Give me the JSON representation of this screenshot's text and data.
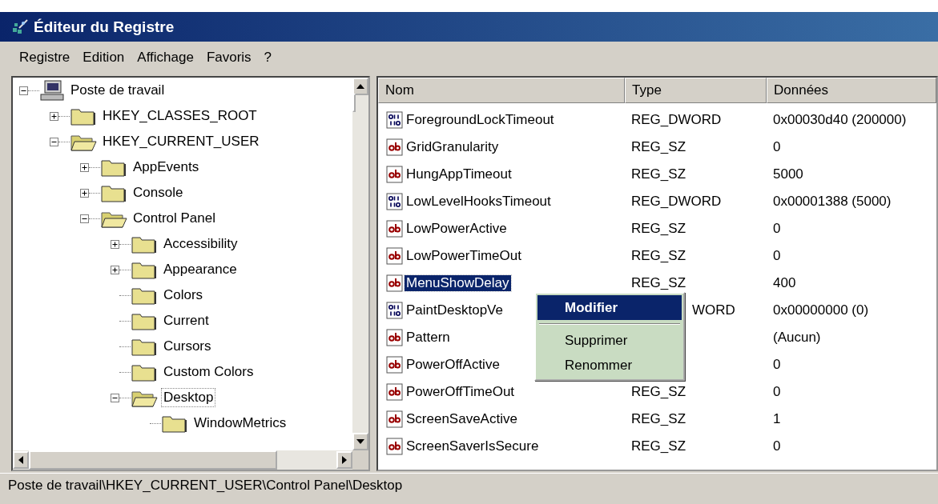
{
  "window": {
    "title": "Éditeur du Registre"
  },
  "menu_bar": [
    "Registre",
    "Edition",
    "Affichage",
    "Favoris",
    "?"
  ],
  "tree": {
    "label": "Poste de travail",
    "kind": "computer",
    "expanded": true,
    "selected": false,
    "children": [
      {
        "label": "HKEY_CLASSES_ROOT",
        "expanded": false,
        "selected": false,
        "has_children": true
      },
      {
        "label": "HKEY_CURRENT_USER",
        "expanded": true,
        "selected": false,
        "has_children": true,
        "children": [
          {
            "label": "AppEvents",
            "expanded": false,
            "selected": false,
            "has_children": true
          },
          {
            "label": "Console",
            "expanded": false,
            "selected": false,
            "has_children": true
          },
          {
            "label": "Control Panel",
            "expanded": true,
            "selected": false,
            "has_children": true,
            "children": [
              {
                "label": "Accessibility",
                "expanded": false,
                "selected": false,
                "has_children": true
              },
              {
                "label": "Appearance",
                "expanded": false,
                "selected": false,
                "has_children": true
              },
              {
                "label": "Colors",
                "selected": false,
                "has_children": false
              },
              {
                "label": "Current",
                "selected": false,
                "has_children": false
              },
              {
                "label": "Cursors",
                "selected": false,
                "has_children": false
              },
              {
                "label": "Custom Colors",
                "selected": false,
                "has_children": false
              },
              {
                "label": "Desktop",
                "expanded": true,
                "selected": true,
                "has_children": true,
                "children": [
                  {
                    "label": "WindowMetrics",
                    "selected": false,
                    "has_children": false
                  }
                ]
              }
            ]
          }
        ]
      }
    ]
  },
  "values": {
    "columns": [
      "Nom",
      "Type",
      "Données"
    ],
    "rows": [
      {
        "kind": "dword",
        "name": "ForegroundLockTimeout",
        "type": "REG_DWORD",
        "data": "0x00030d40 (200000)",
        "selected": false
      },
      {
        "kind": "string",
        "name": "GridGranularity",
        "type": "REG_SZ",
        "data": "0",
        "selected": false
      },
      {
        "kind": "string",
        "name": "HungAppTimeout",
        "type": "REG_SZ",
        "data": "5000",
        "selected": false
      },
      {
        "kind": "dword",
        "name": "LowLevelHooksTimeout",
        "type": "REG_DWORD",
        "data": "0x00001388 (5000)",
        "selected": false
      },
      {
        "kind": "string",
        "name": "LowPowerActive",
        "type": "REG_SZ",
        "data": "0",
        "selected": false
      },
      {
        "kind": "string",
        "name": "LowPowerTimeOut",
        "type": "REG_SZ",
        "data": "0",
        "selected": false
      },
      {
        "kind": "string",
        "name": "MenuShowDelay",
        "type": "REG_SZ",
        "data": "400",
        "selected": true
      },
      {
        "kind": "dword",
        "name": "PaintDesktopVe",
        "type": "WORD",
        "type_cut": true,
        "data": "0x00000000 (0)",
        "selected": false
      },
      {
        "kind": "string",
        "name": "Pattern",
        "data": "(Aucun)",
        "selected": false
      },
      {
        "kind": "string",
        "name": "PowerOffActive",
        "data": "0",
        "selected": false
      },
      {
        "kind": "string",
        "name": "PowerOffTimeOut",
        "type": "REG_SZ",
        "data": "0",
        "selected": false
      },
      {
        "kind": "string",
        "name": "ScreenSaveActive",
        "type": "REG_SZ",
        "data": "1",
        "selected": false
      },
      {
        "kind": "string",
        "name": "ScreenSaverIsSecure",
        "type": "REG_SZ",
        "data": "0",
        "selected": false
      }
    ]
  },
  "context_menu": [
    {
      "kind": "item",
      "label": "Modifier",
      "default": true,
      "selected": true
    },
    {
      "kind": "separator"
    },
    {
      "kind": "item",
      "label": "Supprimer",
      "default": false,
      "selected": false
    },
    {
      "kind": "item",
      "label": "Renommer",
      "default": false,
      "selected": false
    }
  ],
  "status_bar": "Poste de travail\\HKEY_CURRENT_USER\\Control Panel\\Desktop"
}
